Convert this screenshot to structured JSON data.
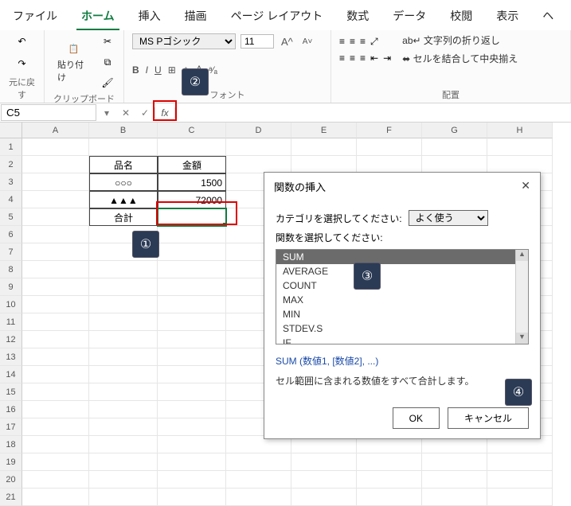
{
  "tabs": [
    "ファイル",
    "ホーム",
    "挿入",
    "描画",
    "ページ レイアウト",
    "数式",
    "データ",
    "校閲",
    "表示",
    "ヘ"
  ],
  "active_tab": 1,
  "ribbon": {
    "undo_group": "元に戻す",
    "clipboard_group": "クリップボード",
    "paste_label": "貼り付け",
    "font_group": "フォント",
    "font_name": "MS Pゴシック",
    "font_size": "11",
    "align_group": "配置",
    "wrap_text": "文字列の折り返し",
    "merge_center": "セルを結合して中央揃え"
  },
  "formula_bar": {
    "name_box": "C5",
    "fx": "fx"
  },
  "columns": [
    "A",
    "B",
    "C",
    "D",
    "E",
    "F",
    "G",
    "H"
  ],
  "rows": 21,
  "table": {
    "hdr_name": "品名",
    "hdr_amount": "金額",
    "r1_name": "○○○",
    "r1_val": "1500",
    "r2_name": "▲▲▲",
    "r2_val": "72000",
    "total_label": "合計"
  },
  "dialog": {
    "title": "関数の挿入",
    "category_label": "カテゴリを選択してください:",
    "category_value": "よく使う",
    "list_label": "関数を選択してください:",
    "functions": [
      "SUM",
      "AVERAGE",
      "COUNT",
      "MAX",
      "MIN",
      "STDEV.S",
      "IF"
    ],
    "selected": "SUM",
    "signature": "SUM (数値1, [数値2], ...)",
    "description": "セル範囲に含まれる数値をすべて合計します。",
    "ok": "OK",
    "cancel": "キャンセル"
  },
  "chart_data": {
    "type": "table",
    "columns": [
      "品名",
      "金額"
    ],
    "rows": [
      [
        "○○○",
        1500
      ],
      [
        "▲▲▲",
        72000
      ],
      [
        "合計",
        null
      ]
    ]
  },
  "badges": {
    "b1": "①",
    "b2": "②",
    "b3": "③",
    "b4": "④"
  }
}
